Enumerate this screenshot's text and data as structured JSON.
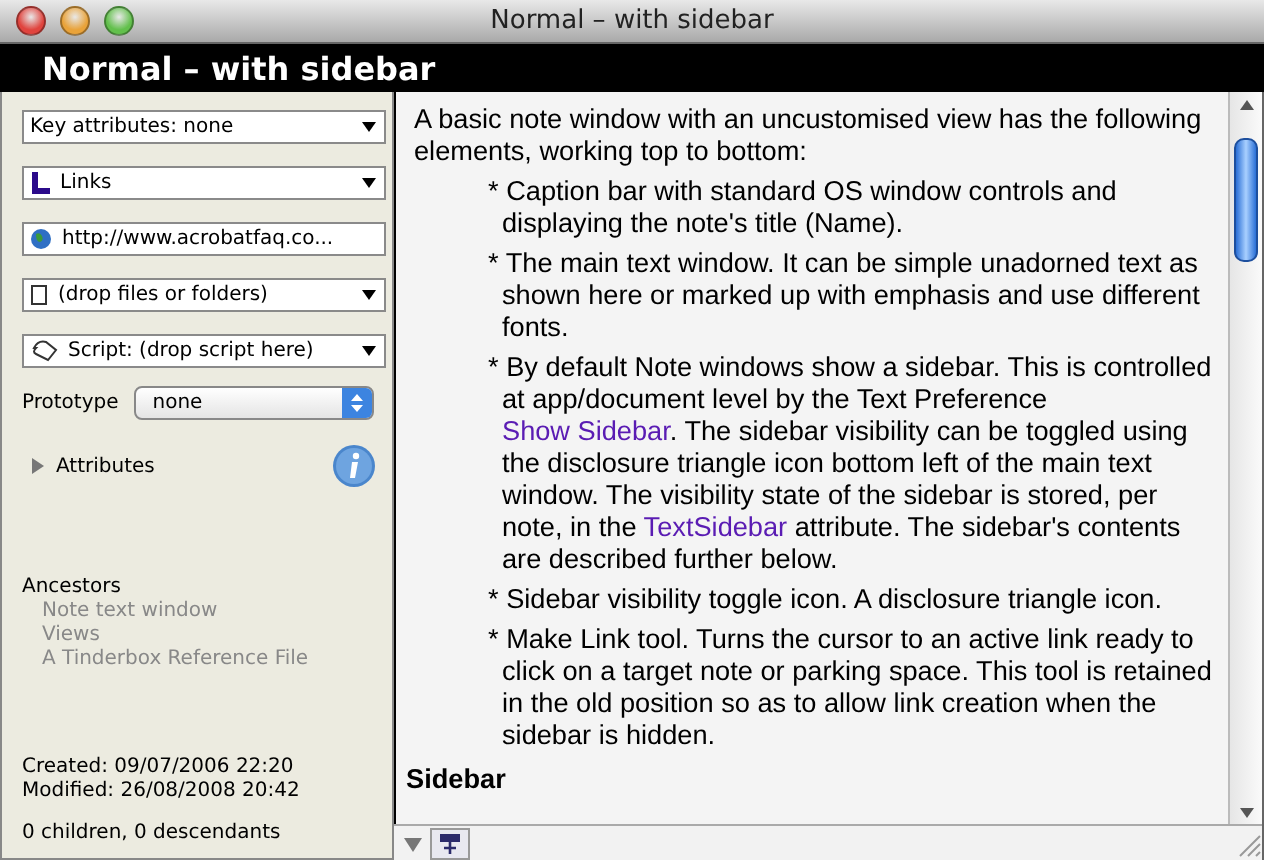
{
  "window": {
    "title": "Normal – with sidebar"
  },
  "header": {
    "title": "Normal – with sidebar"
  },
  "sidebar": {
    "popups": [
      {
        "kind": "plain",
        "label": "Key attributes: none"
      },
      {
        "kind": "links",
        "label": "Links"
      },
      {
        "kind": "url",
        "label": "http://www.acrobatfaq.co..."
      },
      {
        "kind": "file",
        "label": "(drop files or folders)"
      },
      {
        "kind": "script",
        "label": "Script: (drop script here)"
      }
    ],
    "prototype": {
      "label": "Prototype",
      "value": "none"
    },
    "attributes": {
      "label": "Attributes",
      "expanded": false
    },
    "ancestors": {
      "label": "Ancestors",
      "items": [
        "Note text window",
        "Views",
        "A Tinderbox Reference File"
      ]
    },
    "created": "Created: 09/07/2006 22:20",
    "modified": "Modified: 26/08/2008 20:42",
    "counts": "0 children, 0 descendants"
  },
  "text": {
    "intro": "A basic note window with an uncustomised view has the following elements, working top to bottom:",
    "bullets": [
      {
        "marker": "*",
        "parts": [
          {
            "kind": "plain",
            "text": "Caption bar with standard OS window controls and displaying the note's title (Name)."
          }
        ]
      },
      {
        "marker": "*",
        "parts": [
          {
            "kind": "plain",
            "text": "The main text window. It can be simple unadorned text as shown here or marked up with emphasis and use different fonts."
          }
        ]
      },
      {
        "marker": "*",
        "parts": [
          {
            "kind": "plain",
            "text": "By default Note windows show a sidebar.  This is controlled at app/document level by the Text Preference "
          },
          {
            "kind": "link",
            "text": "Show Sidebar"
          },
          {
            "kind": "plain",
            "text": ". The sidebar visibility can be toggled using the disclosure triangle icon bottom left of the main text window. The visibility state of the sidebar is stored, per note, in the "
          },
          {
            "kind": "link",
            "text": "TextSidebar"
          },
          {
            "kind": "plain",
            "text": " attribute. The sidebar's contents are described further below."
          }
        ]
      },
      {
        "marker": "*",
        "parts": [
          {
            "kind": "plain",
            "text": "Sidebar visibility toggle icon. A disclosure triangle icon."
          }
        ]
      },
      {
        "marker": "*",
        "parts": [
          {
            "kind": "plain",
            "text": "Make Link tool. Turns the cursor to an active link ready to click on a target note or parking space. This tool is retained in the old position so as to allow link creation when the sidebar is hidden."
          }
        ]
      }
    ],
    "heading": "Sidebar"
  }
}
